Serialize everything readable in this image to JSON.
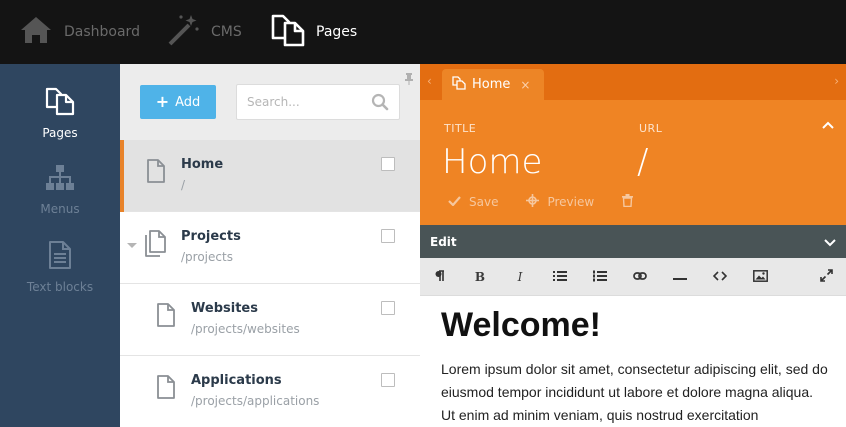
{
  "topnav": {
    "items": [
      {
        "label": "Dashboard",
        "icon": "home-icon",
        "active": false
      },
      {
        "label": "CMS",
        "icon": "magic-wand-icon",
        "active": false
      },
      {
        "label": "Pages",
        "icon": "pages-icon",
        "active": true
      }
    ]
  },
  "sidebar": {
    "items": [
      {
        "label": "Pages",
        "icon": "pages-icon",
        "active": true
      },
      {
        "label": "Menus",
        "icon": "sitemap-icon",
        "active": false
      },
      {
        "label": "Text blocks",
        "icon": "document-icon",
        "active": false
      }
    ]
  },
  "pages_panel": {
    "add_label": "Add",
    "search_placeholder": "Search...",
    "rows": [
      {
        "title": "Home",
        "path": "/",
        "selected": true
      },
      {
        "title": "Projects",
        "path": "/projects",
        "selected": false
      },
      {
        "title": "Websites",
        "path": "/projects/websites",
        "selected": false
      },
      {
        "title": "Applications",
        "path": "/projects/applications",
        "selected": false
      }
    ]
  },
  "editor": {
    "tab_label": "Home",
    "title_label": "TITLE",
    "title_value": "Home",
    "url_label": "URL",
    "url_value": "/",
    "actions": {
      "save": "Save",
      "preview": "Preview"
    },
    "edit_label": "Edit",
    "content_heading": "Welcome!",
    "content_paragraph": "Lorem ipsum dolor sit amet, consectetur adipiscing elit, sed do eiusmod tempor incididunt ut labore et dolore magna aliqua. Ut enim ad minim veniam, quis nostrud exercitation"
  },
  "colors": {
    "topbar": "#141414",
    "sidebar": "#2f4660",
    "accent_orange": "#ef8424",
    "tabbar_orange": "#e36d11",
    "add_button_blue": "#4fb3e8",
    "edit_header": "#495456"
  }
}
